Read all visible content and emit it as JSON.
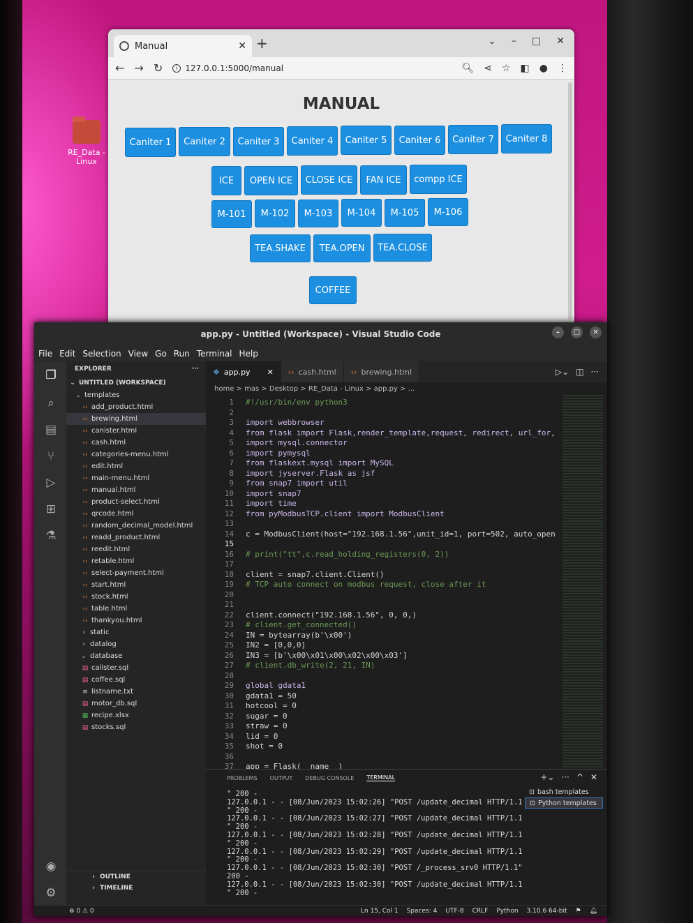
{
  "desktop": {
    "folder_label": "RE_Data - Linux"
  },
  "browser": {
    "tab_title": "Manual",
    "url": "127.0.0.1:5000/manual",
    "page_title": "MANUAL",
    "buttons": [
      "Caniter 1",
      "Caniter 2",
      "Caniter 3",
      "Caniter 4",
      "Caniter 5",
      "Caniter 6",
      "Caniter 7",
      "Caniter 8",
      "ICE",
      "OPEN ICE",
      "CLOSE ICE",
      "FAN ICE",
      "compp ICE",
      "M-101",
      "M-102",
      "M-103",
      "M-104",
      "M-105",
      "M-106",
      "TEA.SHAKE",
      "TEA.OPEN",
      "TEA.CLOSE",
      "COFFEE"
    ],
    "accent": "#1c8fe0"
  },
  "vscode": {
    "title": "app.py - Untitled (Workspace) - Visual Studio Code",
    "menu": [
      "File",
      "Edit",
      "Selection",
      "View",
      "Go",
      "Run",
      "Terminal",
      "Help"
    ],
    "explorer": {
      "header": "EXPLORER",
      "workspace": "UNTITLED (WORKSPACE)",
      "items": [
        {
          "label": "templates",
          "type": "folder-open"
        },
        {
          "label": "add_product.html",
          "type": "html"
        },
        {
          "label": "brewing.html",
          "type": "html"
        },
        {
          "label": "canister.html",
          "type": "html"
        },
        {
          "label": "cash.html",
          "type": "html"
        },
        {
          "label": "categories-menu.html",
          "type": "html"
        },
        {
          "label": "edit.html",
          "type": "html"
        },
        {
          "label": "main-menu.html",
          "type": "html"
        },
        {
          "label": "manual.html",
          "type": "html"
        },
        {
          "label": "product-select.html",
          "type": "html"
        },
        {
          "label": "qrcode.html",
          "type": "html"
        },
        {
          "label": "random_decimal_model.html",
          "type": "html"
        },
        {
          "label": "readd_product.html",
          "type": "html"
        },
        {
          "label": "reedit.html",
          "type": "html"
        },
        {
          "label": "retable.html",
          "type": "html"
        },
        {
          "label": "select-payment.html",
          "type": "html"
        },
        {
          "label": "start.html",
          "type": "html"
        },
        {
          "label": "stock.html",
          "type": "html"
        },
        {
          "label": "table.html",
          "type": "html"
        },
        {
          "label": "thankyou.html",
          "type": "html"
        },
        {
          "label": "static",
          "type": "folder"
        },
        {
          "label": "datalog",
          "type": "folder"
        },
        {
          "label": "database",
          "type": "folder-open"
        },
        {
          "label": "calister.sql",
          "type": "sql"
        },
        {
          "label": "coffee.sql",
          "type": "sql"
        },
        {
          "label": "listname.txt",
          "type": "txt"
        },
        {
          "label": "motor_db.sql",
          "type": "sql"
        },
        {
          "label": "recipe.xlsx",
          "type": "xlsx"
        },
        {
          "label": "stocks.sql",
          "type": "sql"
        }
      ],
      "outline": "OUTLINE",
      "timeline": "TIMELINE"
    },
    "tabs": [
      "app.py",
      "cash.html",
      "brewing.html"
    ],
    "breadcrumb": "home > mas > Desktop > RE_Data - Linux > app.py > ...",
    "code_lines": [
      "#!/usr/bin/env python3",
      "",
      "import webbrowser",
      "from flask import Flask,render_template,request, redirect, url_for,",
      "import mysql.connector",
      "import pymysql",
      "from flaskext.mysql import MySQL",
      "import jyserver.Flask as jsf",
      "from snap7 import util",
      "import snap7",
      "import time",
      "from pyModbusTCP.client import ModbusClient",
      "",
      "c = ModbusClient(host=\"192.168.1.56\",unit_id=1, port=502, auto_open",
      "",
      "# print(\"tt\",c.read_holding_registers(0, 2))",
      "",
      "client = snap7.client.Client()",
      "# TCP auto connect on modbus request, close after it",
      "",
      "",
      "client.connect(\"192.168.1.56\", 0, 0,)",
      "# client.get_connected()",
      "IN = bytearray(b'\\x00')",
      "IN2 = [0,0,0]",
      "IN3 = [b'\\x00\\x01\\x00\\x02\\x00\\x03']",
      "# client.db_write(2, 21, IN)",
      "",
      "global gdata1",
      "gdata1 = 50",
      "hotcool = 0",
      "sugar = 0",
      "straw = 0",
      "lid = 0",
      "shot = 0",
      "",
      "app = Flask(__name__)"
    ],
    "panel_tabs": [
      "PROBLEMS",
      "OUTPUT",
      "DEBUG CONSOLE",
      "TERMINAL"
    ],
    "terminal": "\" 200 -\n127.0.0.1 - - [08/Jun/2023 15:02:26] \"POST /update_decimal HTTP/1.1\n\" 200 -\n127.0.0.1 - - [08/Jun/2023 15:02:27] \"POST /update_decimal HTTP/1.1\n\" 200 -\n127.0.0.1 - - [08/Jun/2023 15:02:28] \"POST /update_decimal HTTP/1.1\n\" 200 -\n127.0.0.1 - - [08/Jun/2023 15:02:29] \"POST /update_decimal HTTP/1.1\n\" 200 -\n127.0.0.1 - - [08/Jun/2023 15:02:30] \"POST /_process_srv0 HTTP/1.1\"\n200 -\n127.0.0.1 - - [08/Jun/2023 15:02:30] \"POST /update_decimal HTTP/1.1\n\" 200 -",
    "terminals": [
      "bash templates",
      "Python templates"
    ],
    "status": {
      "problems": "⊗ 0 ⚠ 0",
      "pos": "Ln 15, Col 1",
      "spaces": "Spaces: 4",
      "enc": "UTF-8",
      "eol": "CRLF",
      "lang": "Python",
      "ver": "3.10.6 64-bit"
    }
  }
}
